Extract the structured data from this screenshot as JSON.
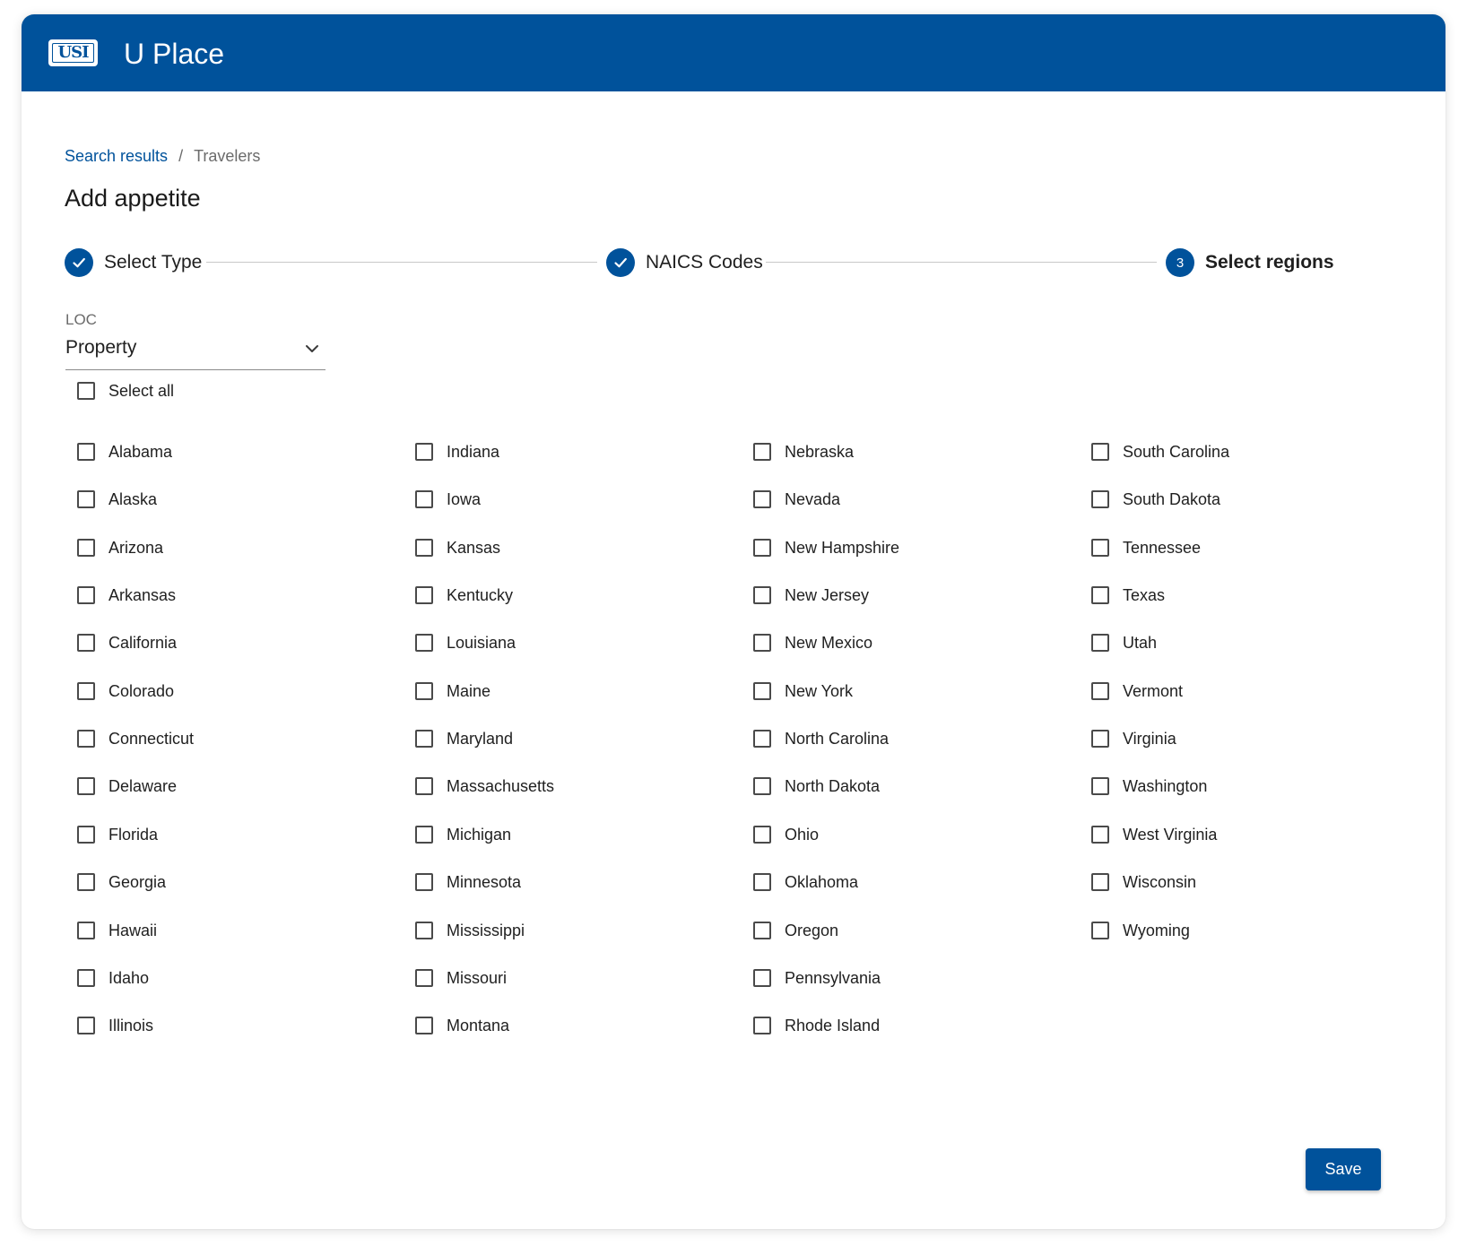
{
  "header": {
    "logo_text": "USI",
    "app_title": "U Place"
  },
  "breadcrumb": {
    "link": "Search results",
    "separator": "/",
    "current": "Travelers"
  },
  "page_title": "Add appetite",
  "stepper": {
    "steps": [
      {
        "label": "Select Type",
        "status": "complete",
        "icon": "check-icon"
      },
      {
        "label": "NAICS Codes",
        "status": "complete",
        "icon": "check-icon"
      },
      {
        "label": "Select regions",
        "status": "active",
        "number": "3"
      }
    ]
  },
  "loc": {
    "label": "LOC",
    "value": "Property"
  },
  "select_all_label": "Select all",
  "regions": {
    "columns": [
      [
        "Alabama",
        "Alaska",
        "Arizona",
        "Arkansas",
        "California",
        "Colorado",
        "Connecticut",
        "Delaware",
        "Florida",
        "Georgia",
        "Hawaii",
        "Idaho",
        "Illinois"
      ],
      [
        "Indiana",
        "Iowa",
        "Kansas",
        "Kentucky",
        "Louisiana",
        "Maine",
        "Maryland",
        "Massachusetts",
        "Michigan",
        "Minnesota",
        "Mississippi",
        "Missouri",
        "Montana"
      ],
      [
        "Nebraska",
        "Nevada",
        "New Hampshire",
        "New Jersey",
        "New Mexico",
        "New York",
        "North Carolina",
        "North Dakota",
        "Ohio",
        "Oklahoma",
        "Oregon",
        "Pennsylvania",
        "Rhode Island"
      ],
      [
        "South Carolina",
        "South Dakota",
        "Tennessee",
        "Texas",
        "Utah",
        "Vermont",
        "Virginia",
        "Washington",
        "West Virginia",
        "Wisconsin",
        "Wyoming"
      ]
    ]
  },
  "save_label": "Save",
  "colors": {
    "brand": "#00529b",
    "checkbox_border": "#4a4a4a",
    "step_line": "#c8c8c8"
  }
}
